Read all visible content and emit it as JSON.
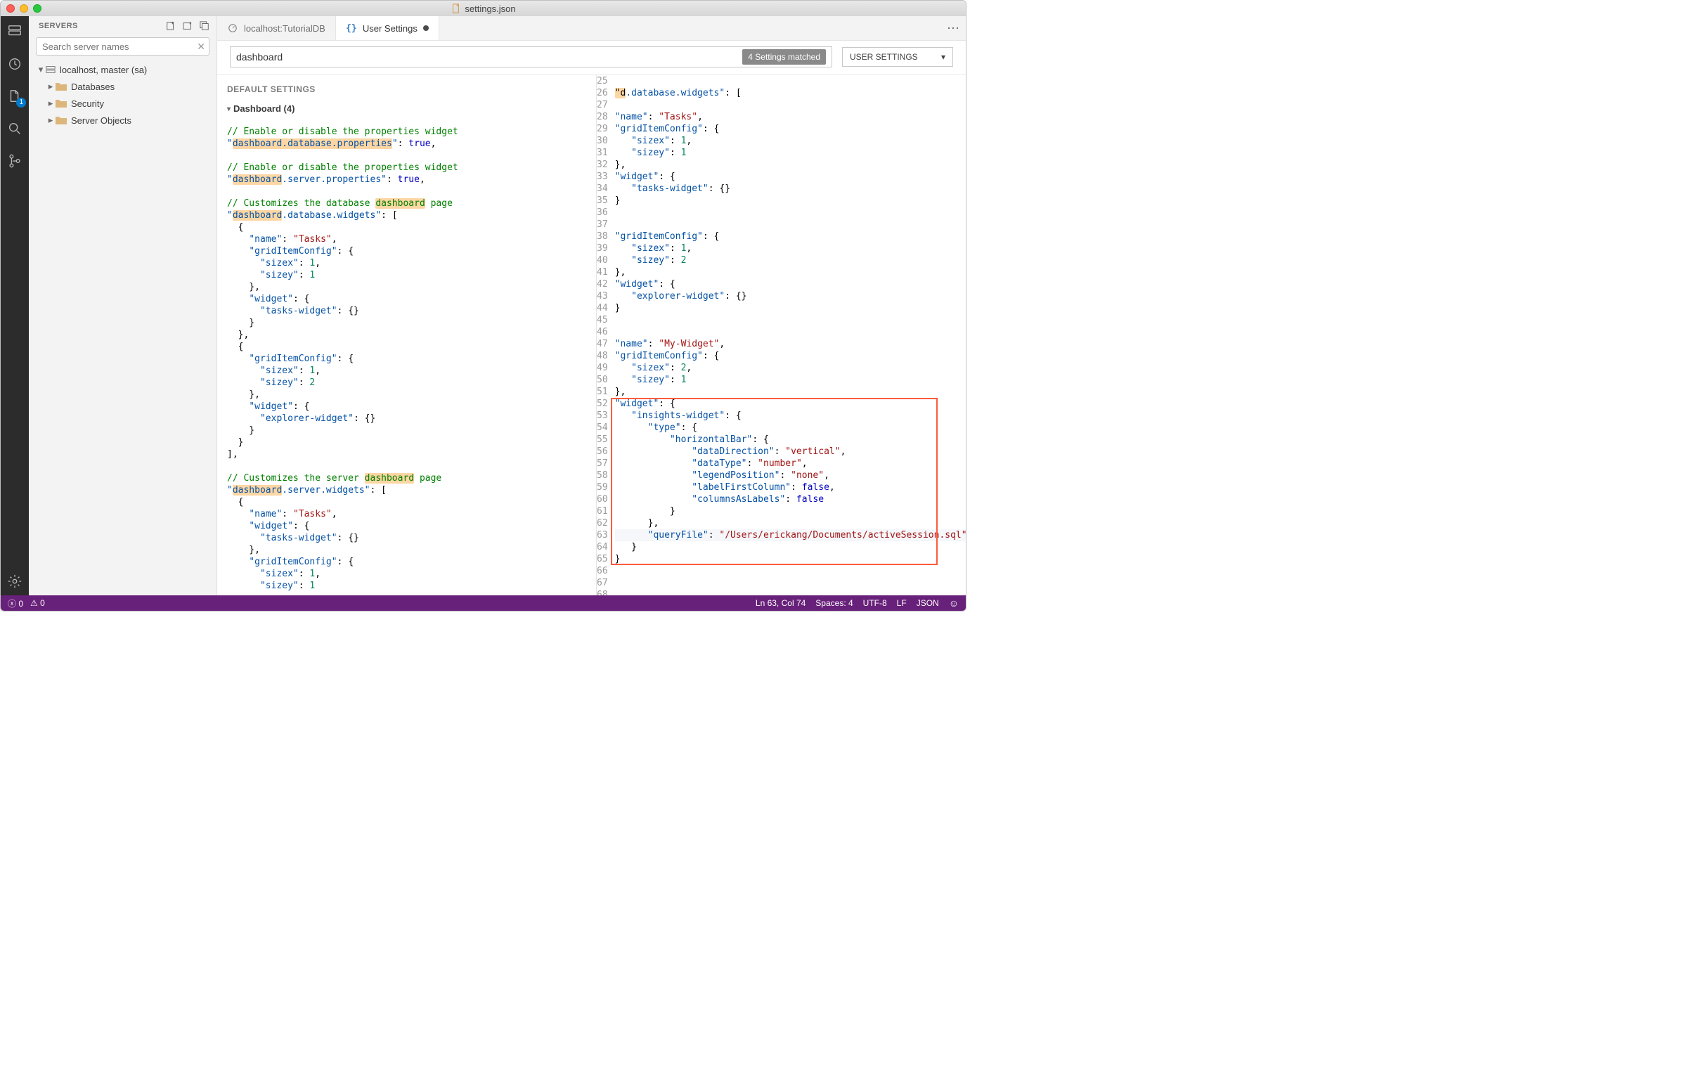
{
  "window": {
    "title": "settings.json"
  },
  "servers_panel": {
    "title": "SERVERS",
    "search_placeholder": "Search server names",
    "root": "localhost, master (sa)",
    "items": [
      "Databases",
      "Security",
      "Server Objects"
    ]
  },
  "tabs": {
    "t1": "localhost:TutorialDB",
    "t2": "User Settings"
  },
  "settings": {
    "search_value": "dashboard",
    "match_badge": "4 Settings matched",
    "scope": "USER SETTINGS",
    "default_title": "DEFAULT SETTINGS",
    "group_title": "Dashboard (4)"
  },
  "left_code": {
    "c1": "// Enable or disable the properties widget",
    "l1_key": "dashboard.database.properties",
    "c2": "// Enable or disable the properties widget",
    "l2_key": "dashboard.server.properties",
    "c3_pre": "// Customizes the database ",
    "c3_hl": "dashboard",
    "c3_post": " page",
    "l3_key": "dashboard.database.widgets",
    "name_tasks": "Tasks",
    "gic": "gridItemConfig",
    "sizex": "sizex",
    "sizey": "sizey",
    "widget": "widget",
    "tasks_widget": "tasks-widget",
    "explorer_widget": "explorer-widget",
    "c4_pre": "// Customizes the server ",
    "c4_hl": "dashboard",
    "c4_post": " page",
    "l4_key": "dashboard.server.widgets"
  },
  "right_code": {
    "start": 25,
    "dbwidgets": "d.database.widgets",
    "name": "name",
    "tasks": "Tasks",
    "gic": "gridItemConfig",
    "sizex": "sizex",
    "sizey": "sizey",
    "widget": "widget",
    "tasks_widget": "tasks-widget",
    "explorer_widget": "explorer-widget",
    "my_widget": "My-Widget",
    "insights_widget": "insights-widget",
    "type": "type",
    "horizontalBar": "horizontalBar",
    "dataDirection": "dataDirection",
    "vertical": "vertical",
    "dataType": "dataType",
    "number": "number",
    "legendPosition": "legendPosition",
    "none": "none",
    "labelFirstColumn": "labelFirstColumn",
    "columnsAsLabels": "columnsAsLabels",
    "queryFile": "queryFile",
    "queryPath": "/Users/erickang/Documents/activeSession.sql"
  },
  "status": {
    "errors": "0",
    "warnings": "0",
    "ln": "Ln 63, Col 74",
    "spaces": "Spaces: 4",
    "enc": "UTF-8",
    "eol": "LF",
    "lang": "JSON"
  }
}
